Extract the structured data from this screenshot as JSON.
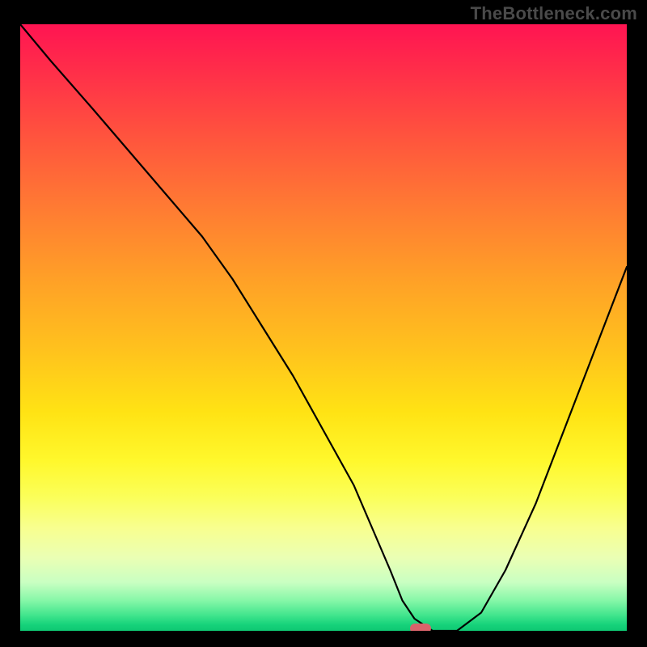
{
  "watermark": "TheBottleneck.com",
  "marker_color": "#d9636b",
  "chart_data": {
    "type": "line",
    "title": "",
    "xlabel": "",
    "ylabel": "",
    "xlim": [
      0,
      100
    ],
    "ylim": [
      0,
      100
    ],
    "series": [
      {
        "name": "curve",
        "x": [
          0,
          5,
          12,
          18,
          24,
          30,
          35,
          40,
          45,
          50,
          55,
          58,
          61,
          63,
          65,
          68,
          72,
          76,
          80,
          85,
          90,
          95,
          100
        ],
        "y": [
          100,
          94,
          86,
          79,
          72,
          65,
          58,
          50,
          42,
          33,
          24,
          17,
          10,
          5,
          2,
          0,
          0,
          3,
          10,
          21,
          34,
          47,
          60
        ]
      }
    ],
    "marker": {
      "x": 66,
      "y": 0
    },
    "background_gradient": {
      "top": "#ff1452",
      "mid": "#ffe314",
      "bottom": "#0fc873"
    }
  }
}
